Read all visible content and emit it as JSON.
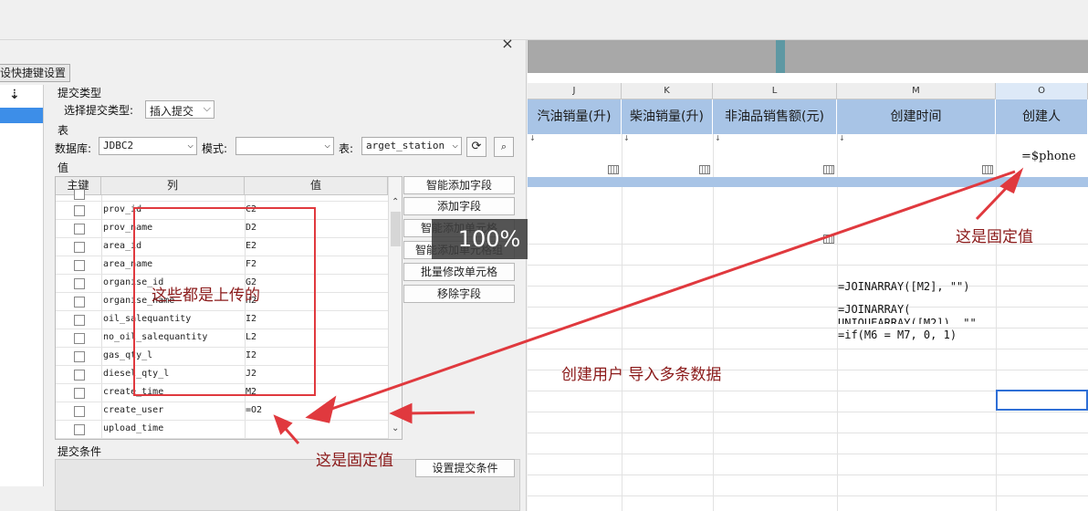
{
  "dialog": {
    "close_glyph": "×",
    "tab_label": "设快捷键设置",
    "section_submit_type": "提交类型",
    "submit_type_label": "选择提交类型:",
    "submit_type_value": "插入提交",
    "section_table": "表",
    "db_label": "数据库:",
    "db_value": "JDBC2",
    "mode_label": "模式:",
    "mode_value": "",
    "table_label": "表:",
    "table_value": "arget_station",
    "section_value": "值",
    "grid_headers": [
      "主键",
      "列",
      "值"
    ],
    "rows": [
      {
        "col": "prov_id",
        "val": "C2"
      },
      {
        "col": "prov_name",
        "val": "D2"
      },
      {
        "col": "area_id",
        "val": "E2"
      },
      {
        "col": "area_name",
        "val": "F2"
      },
      {
        "col": "organise_id",
        "val": "G2"
      },
      {
        "col": "organise_name",
        "val": "H2"
      },
      {
        "col": "oil_salequantity",
        "val": "I2"
      },
      {
        "col": "no_oil_salequantity",
        "val": "L2"
      },
      {
        "col": "gas_qty_l",
        "val": "I2"
      },
      {
        "col": "diesel_qty_l",
        "val": "J2"
      },
      {
        "col": "create_time",
        "val": "M2"
      },
      {
        "col": "create_user",
        "val": "=O2"
      },
      {
        "col": "upload_time",
        "val": ""
      }
    ],
    "side_buttons": [
      "智能添加字段",
      "添加字段",
      "智能添加单元格",
      "智能添加单元格组",
      "批量修改单元格",
      "移除字段"
    ],
    "zoom_label": "100%",
    "section_conditions": "提交条件",
    "set_conditions_button": "设置提交条件"
  },
  "sheet": {
    "column_letters": [
      "J",
      "K",
      "L",
      "M",
      "O"
    ],
    "header_cells": [
      "汽油销量(升)",
      "柴油销量(升)",
      "非油品销售额(元)",
      "创建时间",
      "创建人"
    ],
    "phone_formula": "=$phone",
    "formulas": [
      "=JOINARRAY([M2], \"\")",
      "=JOINARRAY(",
      "UNIQUEARRAY([M2]), \"\"",
      "=if(M6 = M7, 0, 1)"
    ]
  },
  "annotations": {
    "uploaded_note": "这些都是上传的",
    "fixed_value_right": "这是固定值",
    "fixed_value_bottom": "这是固定值",
    "create_user_note": "创建用户  导入多条数据"
  },
  "colors": {
    "annotation_red": "#e0393e",
    "annotation_text": "#8b1a1a",
    "header_blue": "#a8c4e6",
    "selection_blue": "#2f6fd6"
  }
}
